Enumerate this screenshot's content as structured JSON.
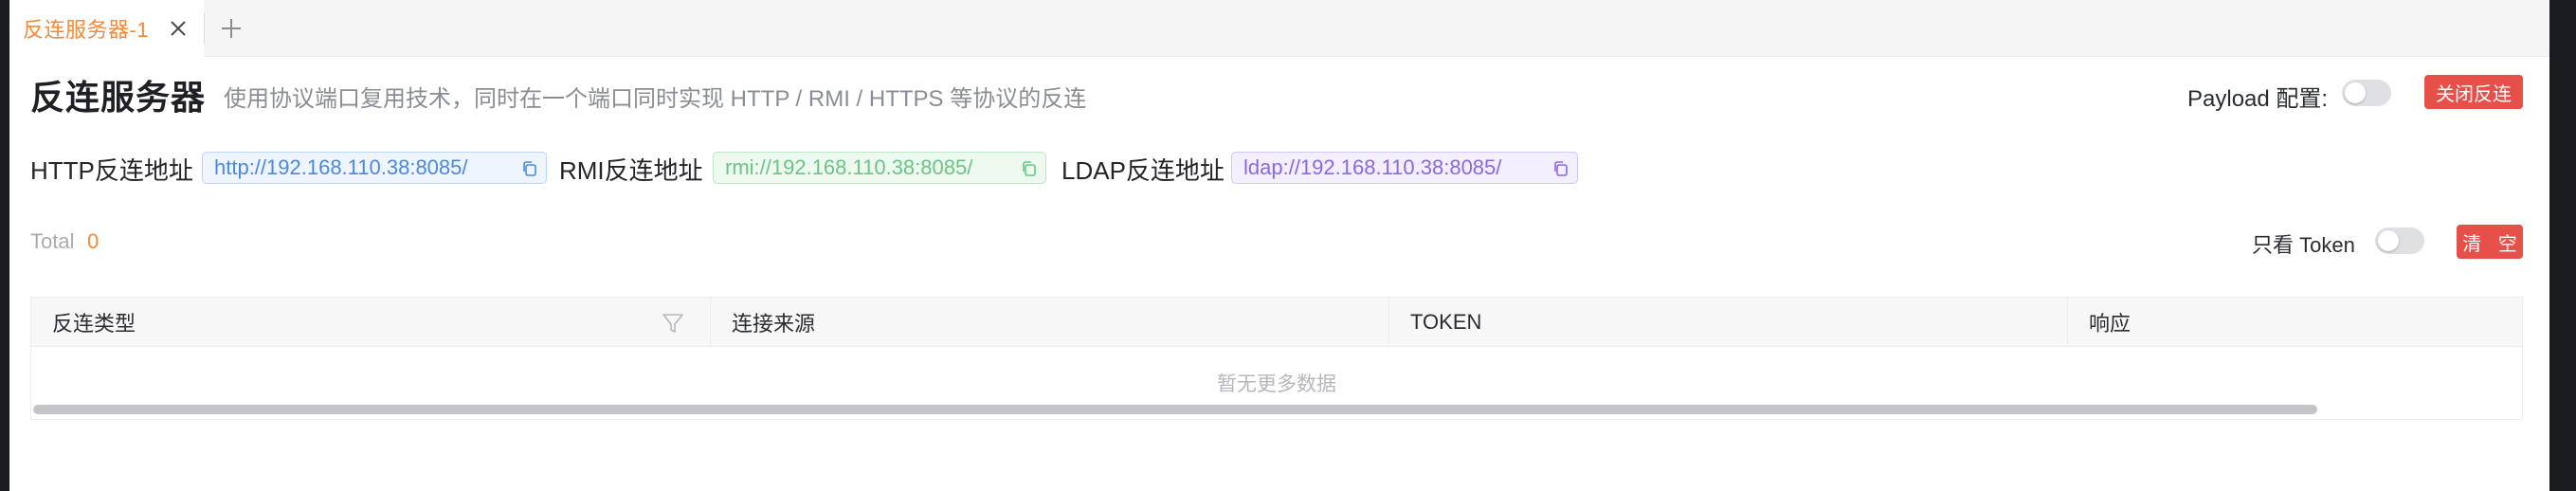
{
  "tab": {
    "title": "反连服务器-1",
    "close_icon": "close-icon",
    "add_icon": "plus-icon"
  },
  "header": {
    "title": "反连服务器",
    "description": "使用协议端口复用技术，同时在一个端口同时实现 HTTP / RMI / HTTPS 等协议的反连",
    "payload_label": "Payload 配置:",
    "payload_enabled": false,
    "close_button": "关闭反连"
  },
  "addresses": {
    "http_label": "HTTP反连地址",
    "http_value": "http://192.168.110.38:8085/",
    "rmi_label": "RMI反连地址",
    "rmi_value": "rmi://192.168.110.38:8085/",
    "ldap_label": "LDAP反连地址",
    "ldap_value": "ldap://192.168.110.38:8085/",
    "copy_icon": "copy-icon"
  },
  "toolbar": {
    "total_label": "Total",
    "total_value": "0",
    "token_only_label": "只看 Token",
    "token_only_enabled": false,
    "clear_button": "清 空"
  },
  "table": {
    "columns": [
      "反连类型",
      "连接来源",
      "TOKEN",
      "响应"
    ],
    "empty_text": "暂无更多数据",
    "filter_icon": "filter-icon"
  },
  "colors": {
    "accent_orange": "#f28a3a",
    "danger_red": "#e65048",
    "http_blue": "#4b88e0",
    "rmi_green": "#6ac485",
    "ldap_purple": "#8a68e2"
  }
}
